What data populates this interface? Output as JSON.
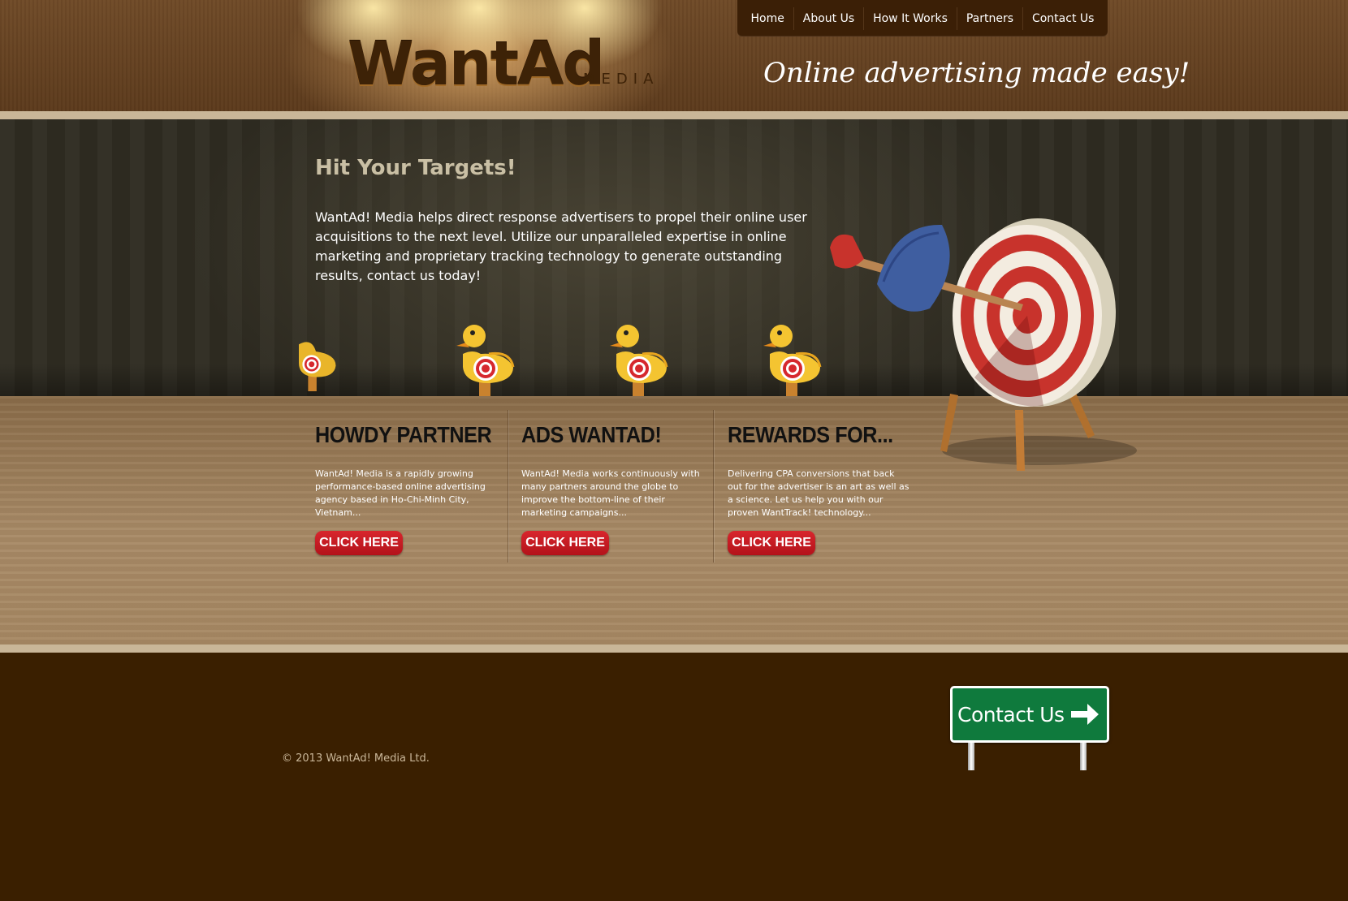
{
  "brand": {
    "logo_main": "WantAd",
    "logo_sub": "MEDIA",
    "tagline": "Online advertising made easy!"
  },
  "nav": {
    "items": [
      {
        "label": "Home"
      },
      {
        "label": "About Us"
      },
      {
        "label": "How It Works"
      },
      {
        "label": "Partners"
      },
      {
        "label": "Contact Us"
      }
    ]
  },
  "hero": {
    "title": "Hit Your Targets!",
    "body": "WantAd! Media helps direct response advertisers to propel their online user acquisitions to the next level. Utilize our unparalleled expertise in online marketing and proprietary tracking technology to generate outstanding results, contact us today!"
  },
  "columns": [
    {
      "heading": "HOWDY PARTNER",
      "text": "WantAd! Media is a rapidly growing performance-based online advertising agency based in Ho-Chi-Minh City, Vietnam...",
      "button": "CLICK HERE"
    },
    {
      "heading": "ADS WANTAD!",
      "text": "WantAd! Media works continuously with many partners around the globe to improve the bottom-line of their marketing campaigns...",
      "button": "CLICK HERE"
    },
    {
      "heading": "REWARDS FOR...",
      "text": "Delivering CPA conversions that back out for the advertiser is an art as well as a science. Let us help you with our proven WantTrack! technology...",
      "button": "CLICK HERE"
    }
  ],
  "footer": {
    "copyright": "© 2013 WantAd! Media Ltd.",
    "contact_sign": "Contact Us",
    "contact_icon": "arrow-right-icon"
  },
  "colors": {
    "header_brown": "#6f4a27",
    "footer_brown": "#3a1f00",
    "button_red": "#c81b22",
    "sign_green": "#0f7a3d",
    "hero_title": "#c9bfa4"
  }
}
